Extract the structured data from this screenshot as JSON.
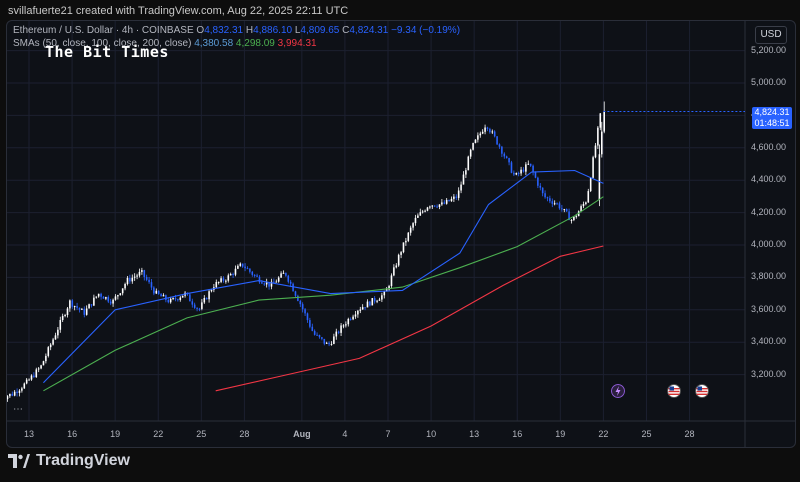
{
  "header": {
    "text": "svillafuerte21 created with TradingView.com, Aug 22, 2025 22:11 UTC"
  },
  "legend": {
    "symbol": "Ethereum / U.S. Dollar · 4h · COINBASE",
    "o_label": "O",
    "o": "4,832.31",
    "h_label": "H",
    "h": "4,886.10",
    "l_label": "L",
    "l": "4,809.65",
    "c_label": "C",
    "c": "4,824.31",
    "change": "−9.34 (−0.19%)",
    "smas_label": "SMAs (50, close, 100, close, 200, close)",
    "sma50": "4,380.58",
    "sma100": "4,298.09",
    "sma200": "3,994.31"
  },
  "watermark": "The Bit Times",
  "currency_button": "USD",
  "price_axis": [
    "5,200.00",
    "5,000.00",
    "4,800.00",
    "4,600.00",
    "4,400.00",
    "4,200.00",
    "4,000.00",
    "3,800.00",
    "3,600.00",
    "3,400.00",
    "3,200.00"
  ],
  "last_price": {
    "price": "4,824.31",
    "countdown": "01:48:51"
  },
  "date_axis": [
    "13",
    "16",
    "19",
    "22",
    "25",
    "28",
    "Aug",
    "4",
    "7",
    "10",
    "13",
    "16",
    "19",
    "22",
    "25",
    "28"
  ],
  "footer": {
    "brand": "TradingView"
  },
  "colors": {
    "up": "#ffffff",
    "down": "#2962ff",
    "sma50": "#2962ff",
    "sma100": "#4caf50",
    "sma200": "#f23645",
    "background": "#0e1117"
  },
  "icons": [
    "tradingview-logo-icon",
    "lightning-event-icon",
    "us-flag-event-icon"
  ],
  "chart_data": {
    "type": "candlestick",
    "title": "Ethereum / U.S. Dollar · 4h · COINBASE",
    "ylim": [
      3100,
      5300
    ],
    "close_path": [
      [
        "Jul 11",
        3050
      ],
      [
        "Jul 12",
        3080
      ],
      [
        "Jul 13",
        3150
      ],
      [
        "Jul 14",
        3250
      ],
      [
        "Jul 15",
        3450
      ],
      [
        "Jul 16",
        3650
      ],
      [
        "Jul 17",
        3580
      ],
      [
        "Jul 18",
        3700
      ],
      [
        "Jul 19",
        3650
      ],
      [
        "Jul 20",
        3780
      ],
      [
        "Jul 21",
        3830
      ],
      [
        "Jul 22",
        3700
      ],
      [
        "Jul 23",
        3650
      ],
      [
        "Jul 24",
        3700
      ],
      [
        "Jul 25",
        3600
      ],
      [
        "Jul 26",
        3750
      ],
      [
        "Jul 27",
        3800
      ],
      [
        "Jul 28",
        3880
      ],
      [
        "Jul 29",
        3800
      ],
      [
        "Jul 30",
        3750
      ],
      [
        "Jul 31",
        3830
      ],
      [
        "Aug 1",
        3650
      ],
      [
        "Aug 2",
        3450
      ],
      [
        "Aug 3",
        3380
      ],
      [
        "Aug 4",
        3500
      ],
      [
        "Aug 5",
        3600
      ],
      [
        "Aug 6",
        3650
      ],
      [
        "Aug 7",
        3700
      ],
      [
        "Aug 8",
        3950
      ],
      [
        "Aug 9",
        4150
      ],
      [
        "Aug 10",
        4250
      ],
      [
        "Aug 11",
        4250
      ],
      [
        "Aug 12",
        4300
      ],
      [
        "Aug 13",
        4600
      ],
      [
        "Aug 14",
        4750
      ],
      [
        "Aug 15",
        4600
      ],
      [
        "Aug 16",
        4420
      ],
      [
        "Aug 17",
        4500
      ],
      [
        "Aug 18",
        4300
      ],
      [
        "Aug 19",
        4250
      ],
      [
        "Aug 20",
        4150
      ],
      [
        "Aug 21",
        4280
      ],
      [
        "Aug 22",
        4824
      ]
    ],
    "sma50_path": [
      [
        "Jul 14",
        3150
      ],
      [
        "Jul 19",
        3600
      ],
      [
        "Jul 24",
        3700
      ],
      [
        "Jul 29",
        3780
      ],
      [
        "Aug 3",
        3700
      ],
      [
        "Aug 8",
        3720
      ],
      [
        "Aug 12",
        3950
      ],
      [
        "Aug 14",
        4250
      ],
      [
        "Aug 17",
        4450
      ],
      [
        "Aug 20",
        4460
      ],
      [
        "Aug 22",
        4380
      ]
    ],
    "sma100_path": [
      [
        "Jul 14",
        3100
      ],
      [
        "Jul 19",
        3350
      ],
      [
        "Jul 24",
        3550
      ],
      [
        "Jul 29",
        3660
      ],
      [
        "Aug 3",
        3690
      ],
      [
        "Aug 8",
        3740
      ],
      [
        "Aug 12",
        3860
      ],
      [
        "Aug 16",
        3990
      ],
      [
        "Aug 20",
        4180
      ],
      [
        "Aug 22",
        4298
      ]
    ],
    "sma200_path": [
      [
        "Jul 26",
        3100
      ],
      [
        "Jul 31",
        3200
      ],
      [
        "Aug 5",
        3300
      ],
      [
        "Aug 10",
        3500
      ],
      [
        "Aug 15",
        3750
      ],
      [
        "Aug 19",
        3930
      ],
      [
        "Aug 22",
        3994
      ]
    ]
  }
}
